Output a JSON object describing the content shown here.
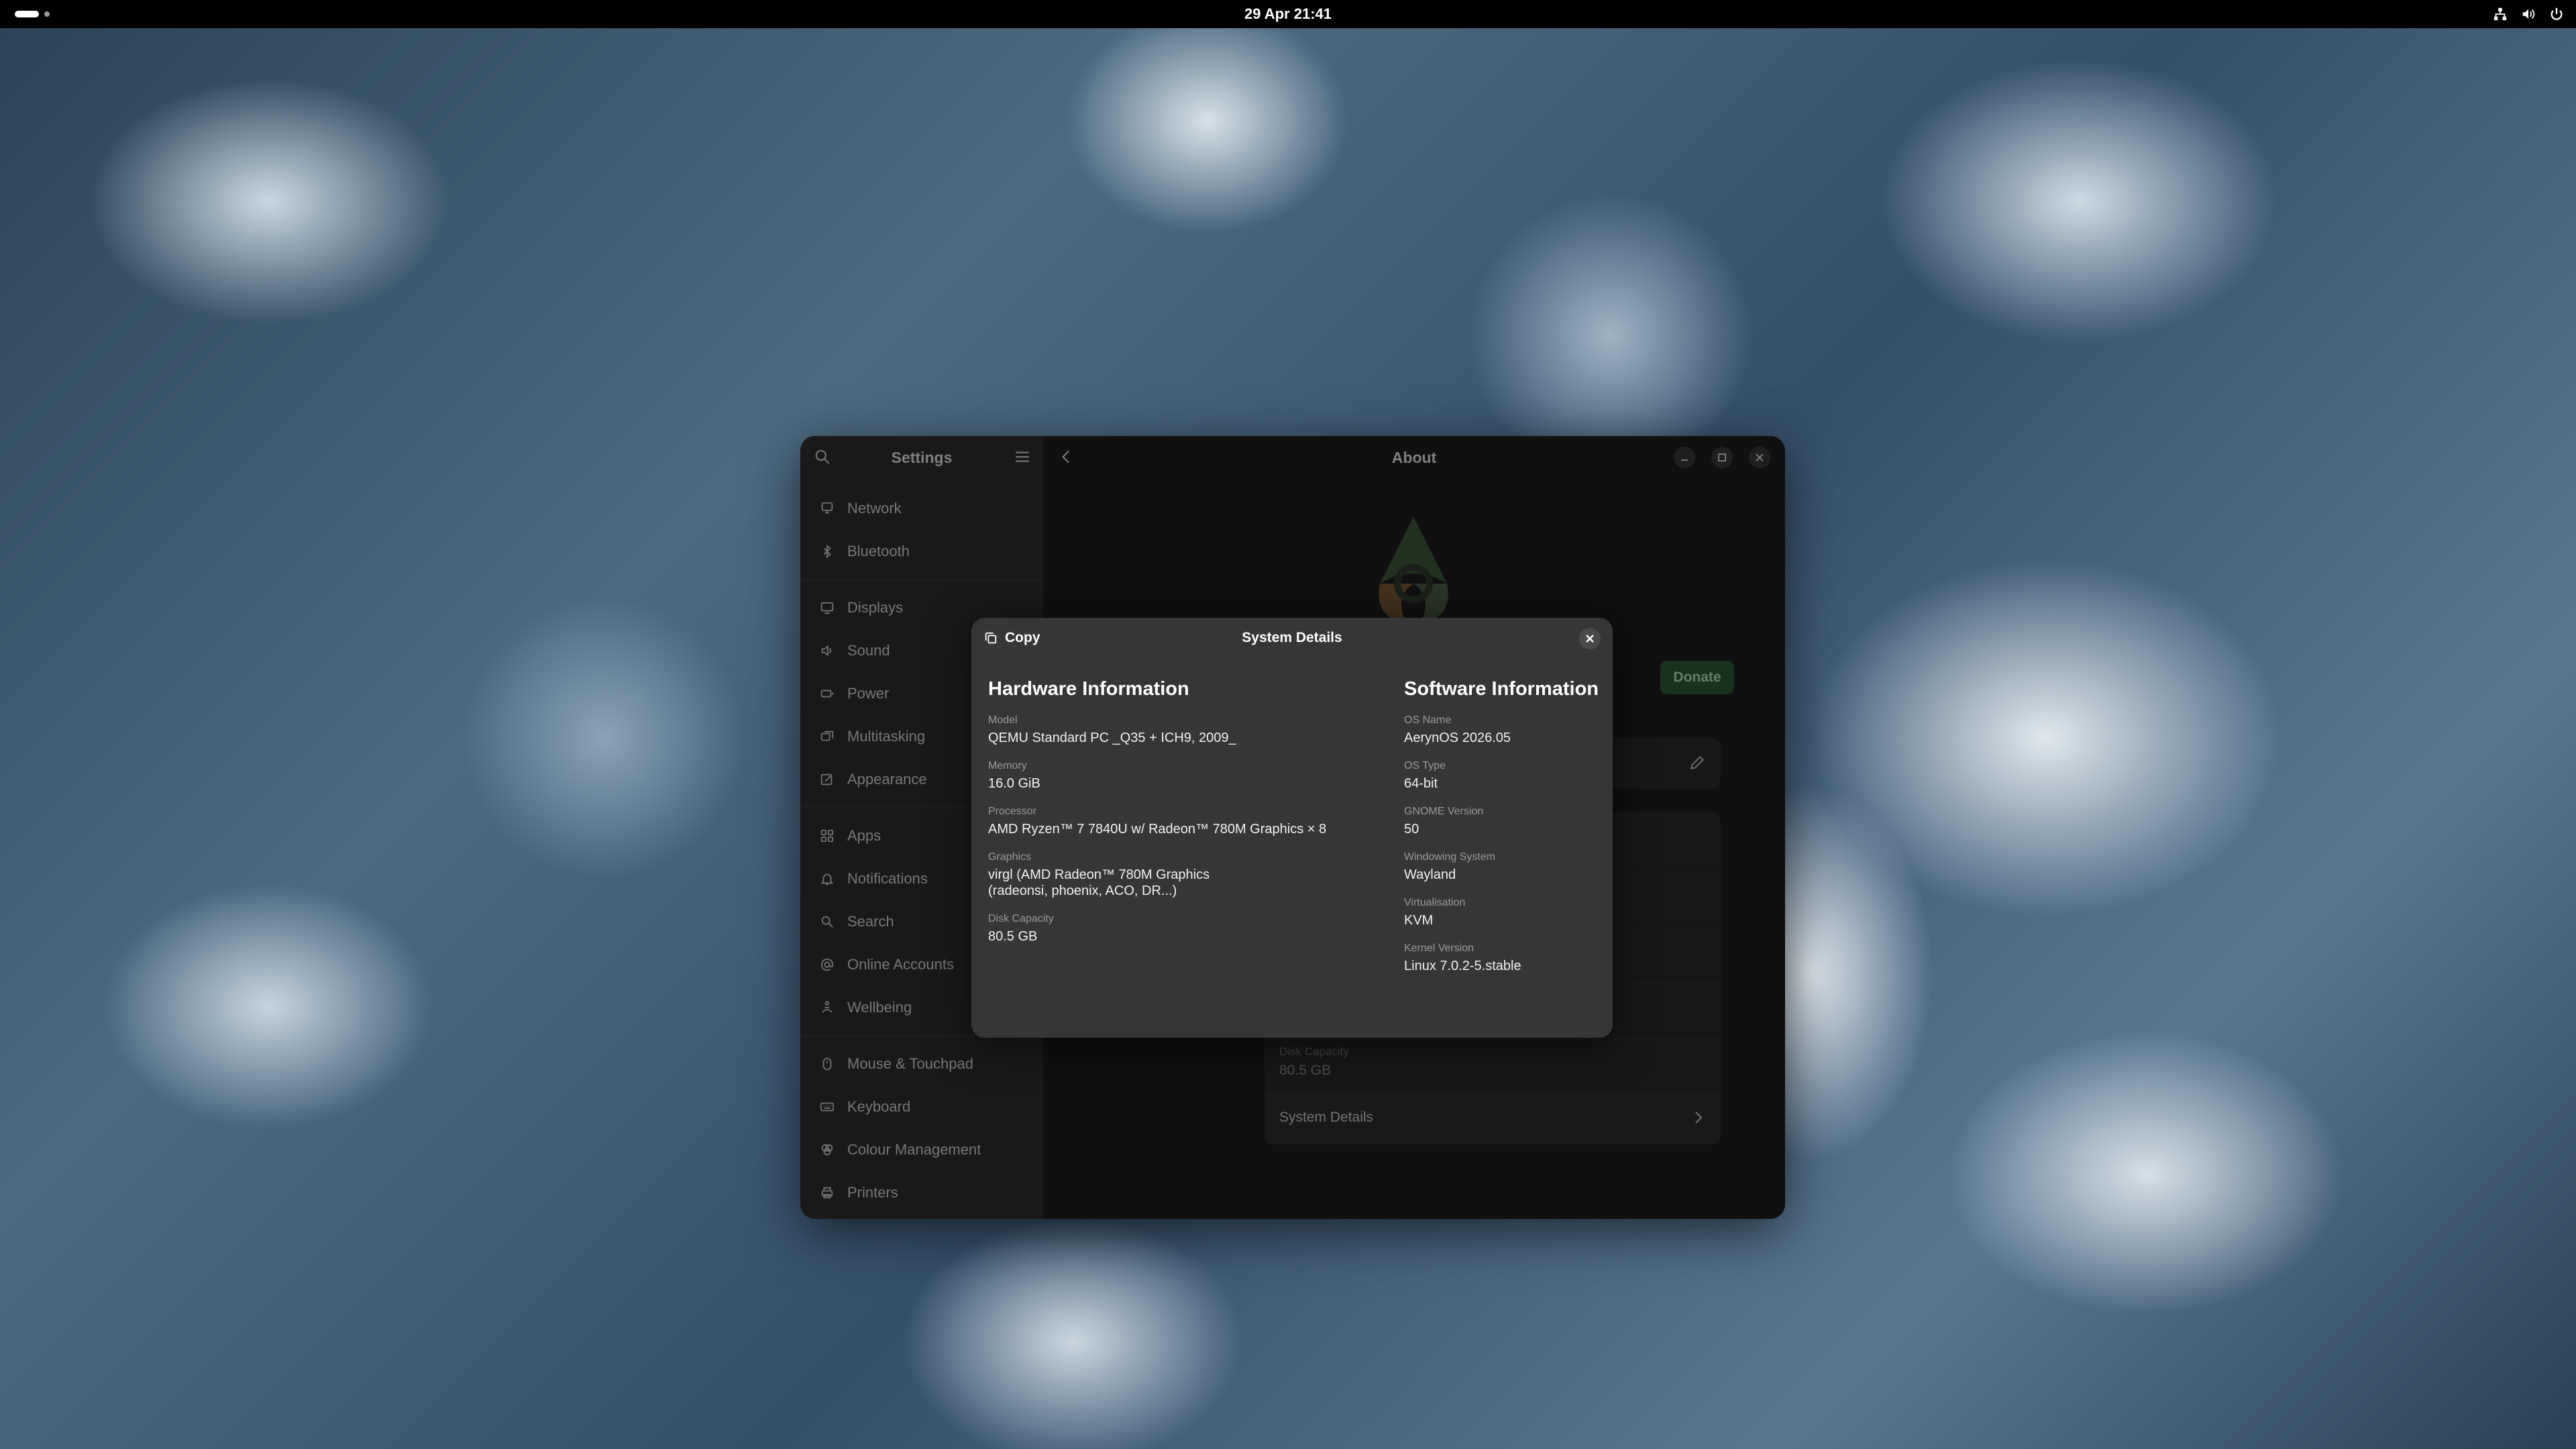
{
  "topbar": {
    "clock": "29 Apr  21:41",
    "tray_icons": [
      "network-wired-icon",
      "volume-icon",
      "power-icon"
    ]
  },
  "settings": {
    "sidebar_title": "Settings",
    "sidebar_groups": [
      [
        {
          "label": "Network",
          "icon": "network-icon"
        },
        {
          "label": "Bluetooth",
          "icon": "bluetooth-icon"
        }
      ],
      [
        {
          "label": "Displays",
          "icon": "display-icon"
        },
        {
          "label": "Sound",
          "icon": "speaker-icon"
        },
        {
          "label": "Power",
          "icon": "power-icon"
        },
        {
          "label": "Multitasking",
          "icon": "multitasking-icon"
        },
        {
          "label": "Appearance",
          "icon": "appearance-icon"
        }
      ],
      [
        {
          "label": "Apps",
          "icon": "apps-icon"
        },
        {
          "label": "Notifications",
          "icon": "bell-icon"
        },
        {
          "label": "Search",
          "icon": "search-icon"
        },
        {
          "label": "Online Accounts",
          "icon": "at-icon"
        },
        {
          "label": "Wellbeing",
          "icon": "wellbeing-icon"
        }
      ],
      [
        {
          "label": "Mouse & Touchpad",
          "icon": "mouse-icon"
        },
        {
          "label": "Keyboard",
          "icon": "keyboard-icon"
        },
        {
          "label": "Colour Management",
          "icon": "colour-icon"
        },
        {
          "label": "Printers",
          "icon": "printer-icon"
        }
      ]
    ],
    "page_title": "About",
    "donate_label": "Donate",
    "disk_capacity_label": "Disk Capacity",
    "disk_capacity_value": "80.5 GB",
    "system_details_label": "System Details"
  },
  "dialog": {
    "copy_label": "Copy",
    "title": "System Details",
    "hardware": {
      "title": "Hardware Information",
      "fields": [
        {
          "label": "Model",
          "value": "QEMU Standard PC _Q35 + ICH9, 2009_"
        },
        {
          "label": "Memory",
          "value": "16.0 GiB"
        },
        {
          "label": "Processor",
          "value": "AMD Ryzen™ 7 7840U w/ Radeon™ 780M Graphics × 8"
        },
        {
          "label": "Graphics",
          "value": "virgl (AMD Radeon™ 780M Graphics",
          "value2": "(radeonsi, phoenix, ACO, DR...)"
        },
        {
          "label": "Disk Capacity",
          "value": "80.5 GB"
        }
      ]
    },
    "software": {
      "title": "Software Information",
      "fields": [
        {
          "label": "OS Name",
          "value": "AerynOS 2026.05"
        },
        {
          "label": "OS Type",
          "value": "64-bit"
        },
        {
          "label": "GNOME Version",
          "value": "50"
        },
        {
          "label": "Windowing System",
          "value": "Wayland"
        },
        {
          "label": "Virtualisation",
          "value": "KVM"
        },
        {
          "label": "Kernel Version",
          "value": "Linux 7.0.2-5.stable"
        }
      ]
    }
  },
  "colors": {
    "accent_green": "#2a5e36",
    "dialog_bg": "#363636",
    "sidebar_bg": "#2e2e32"
  }
}
